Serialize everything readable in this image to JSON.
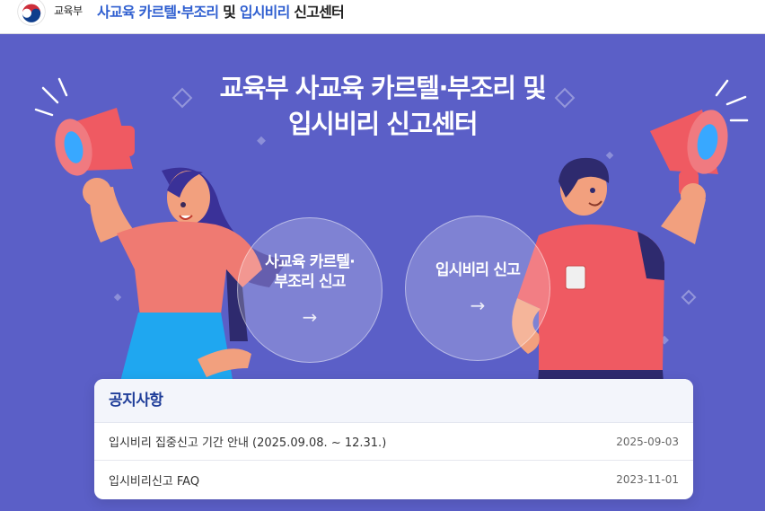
{
  "header": {
    "ministry": "교육부",
    "title_blue_1": "사교육 카르텔·부조리",
    "title_dark_1": " 및 ",
    "title_blue_2": "입시비리",
    "title_dark_2": " 신고센터"
  },
  "hero": {
    "title_line1": "교육부 사교육 카르텔·부조리 및",
    "title_line2": "입시비리 신고센터"
  },
  "actions": [
    {
      "label": "사교육 카르텔·\n부조리 신고",
      "arrow": "→"
    },
    {
      "label": "입시비리 신고",
      "arrow": "→"
    }
  ],
  "notice": {
    "title": "공지사항",
    "items": [
      {
        "text": "입시비리 집중신고 기간 안내 (2025.09.08. ~ 12.31.)",
        "date": "2025-09-03"
      },
      {
        "text": "입시비리신고 FAQ",
        "date": "2023-11-01"
      }
    ]
  },
  "colors": {
    "background": "#5b5fc7",
    "accent_blue": "#2f5fd0",
    "notice_title": "#1f3d99",
    "megaphone_red": "#ef5a62"
  }
}
